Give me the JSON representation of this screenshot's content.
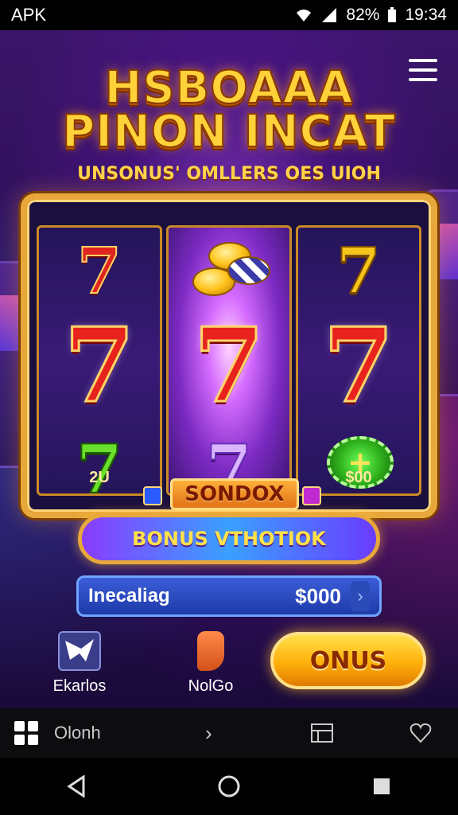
{
  "status_bar": {
    "app_label": "APK",
    "battery": "82%",
    "time": "19:34"
  },
  "game": {
    "title_line1": "HSBOAAA",
    "title_line2": "PINON INCAT",
    "subtitle": "UNSONUS' OMLLERS OES UIOH",
    "reels": [
      {
        "top": "7",
        "middle": "7",
        "bottom": "7",
        "label": "2U"
      },
      {
        "top": "",
        "middle": "7",
        "bottom": "7",
        "label": ""
      },
      {
        "top": "7",
        "middle": "7",
        "bottom": "+",
        "label": "$00"
      }
    ],
    "center_badge": "SONDOX",
    "bonus_button": "BONUS VTHOTIOK",
    "bet_label": "Inecaliag",
    "bet_value": "$000",
    "bet_arrow": "›",
    "controls": [
      {
        "label": "Ekarlos",
        "icon": "bird-icon"
      },
      {
        "label": "NolGo",
        "icon": "tag-icon"
      }
    ],
    "spin_button": "ONUS"
  },
  "app_bar": {
    "app_name": "Olonh",
    "chevron": "›"
  },
  "colors": {
    "accent_gold": "#ffd23a",
    "frame_gold": "#e8a73a",
    "background_purple": "#2a0e55"
  }
}
